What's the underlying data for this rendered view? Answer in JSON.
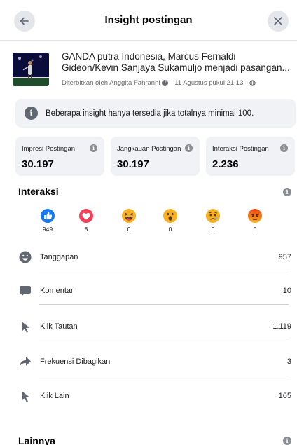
{
  "header": {
    "title": "Insight postingan",
    "back_icon": "arrow-left-icon",
    "close_icon": "close-icon"
  },
  "post": {
    "title": "GANDA putra Indonesia, Marcus Fernaldi Gideon/Kevin Sanjaya Sukamuljo menjadi pasangan...",
    "meta_author": "Diterbitkan oleh Anggita Fahranni",
    "meta_date": "· 11 Agustus pukul 21.13 ·"
  },
  "notice": {
    "text": "Beberapa insight hanya tersedia jika totalnya minimal 100."
  },
  "stats": [
    {
      "label": "Impresi Postingan",
      "value": "30.197"
    },
    {
      "label": "Jangkauan Postingan",
      "value": "30.197"
    },
    {
      "label": "Interaksi Postingan",
      "value": "2.236"
    }
  ],
  "interactions": {
    "title": "Interaksi",
    "reactions": [
      {
        "icon": "like-icon",
        "count": "949",
        "color": "#1877f2"
      },
      {
        "icon": "love-icon",
        "count": "8",
        "color": "#f33e58"
      },
      {
        "icon": "haha-icon",
        "count": "0",
        "color": "#f7b125"
      },
      {
        "icon": "wow-icon",
        "count": "0",
        "color": "#f7b125"
      },
      {
        "icon": "sad-icon",
        "count": "0",
        "color": "#f7b125"
      },
      {
        "icon": "angry-icon",
        "count": "0",
        "color": "#e9710f"
      }
    ],
    "rows": [
      {
        "icon": "smiley-icon",
        "label": "Tanggapan",
        "value": "957"
      },
      {
        "icon": "comment-icon",
        "label": "Komentar",
        "value": "10"
      },
      {
        "icon": "cursor-icon",
        "label": "Klik Tautan",
        "value": "1.119"
      },
      {
        "icon": "share-icon",
        "label": "Frekuensi Dibagikan",
        "value": "3"
      },
      {
        "icon": "cursor-icon",
        "label": "Klik Lain",
        "value": "165"
      }
    ]
  },
  "other": {
    "title": "Lainnya"
  }
}
